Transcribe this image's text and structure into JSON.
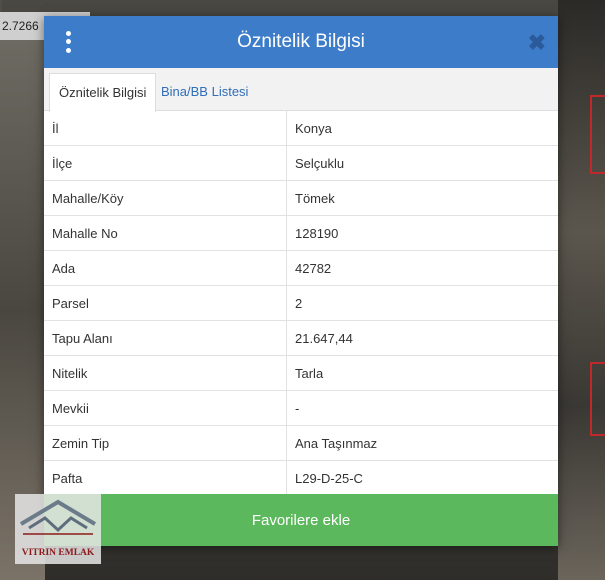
{
  "map": {
    "coordinate_text": "2.7266"
  },
  "dialog": {
    "title": "Öznitelik Bilgisi",
    "tabs": [
      {
        "label": "Öznitelik Bilgisi",
        "active": true
      },
      {
        "label": "Bina/BB Listesi",
        "active": false
      }
    ],
    "rows": [
      {
        "key": "İl",
        "value": "Konya"
      },
      {
        "key": "İlçe",
        "value": "Selçuklu"
      },
      {
        "key": "Mahalle/Köy",
        "value": "Tömek"
      },
      {
        "key": "Mahalle No",
        "value": "128190"
      },
      {
        "key": "Ada",
        "value": "42782"
      },
      {
        "key": "Parsel",
        "value": "2"
      },
      {
        "key": "Tapu Alanı",
        "value": "21.647,44"
      },
      {
        "key": "Nitelik",
        "value": "Tarla"
      },
      {
        "key": "Mevkii",
        "value": "-"
      },
      {
        "key": "Zemin Tip",
        "value": "Ana Taşınmaz"
      },
      {
        "key": "Pafta",
        "value": "L29-D-25-C"
      }
    ],
    "favorite_button": "Favorilere ekle",
    "close_icon": "close-icon",
    "menu_icon": "vertical-dots-icon"
  },
  "logo": {
    "text": "VITRIN EMLAK"
  },
  "colors": {
    "header": "#3d7cc9",
    "button": "#5cb85c",
    "tab_link": "#2f6eb8"
  }
}
